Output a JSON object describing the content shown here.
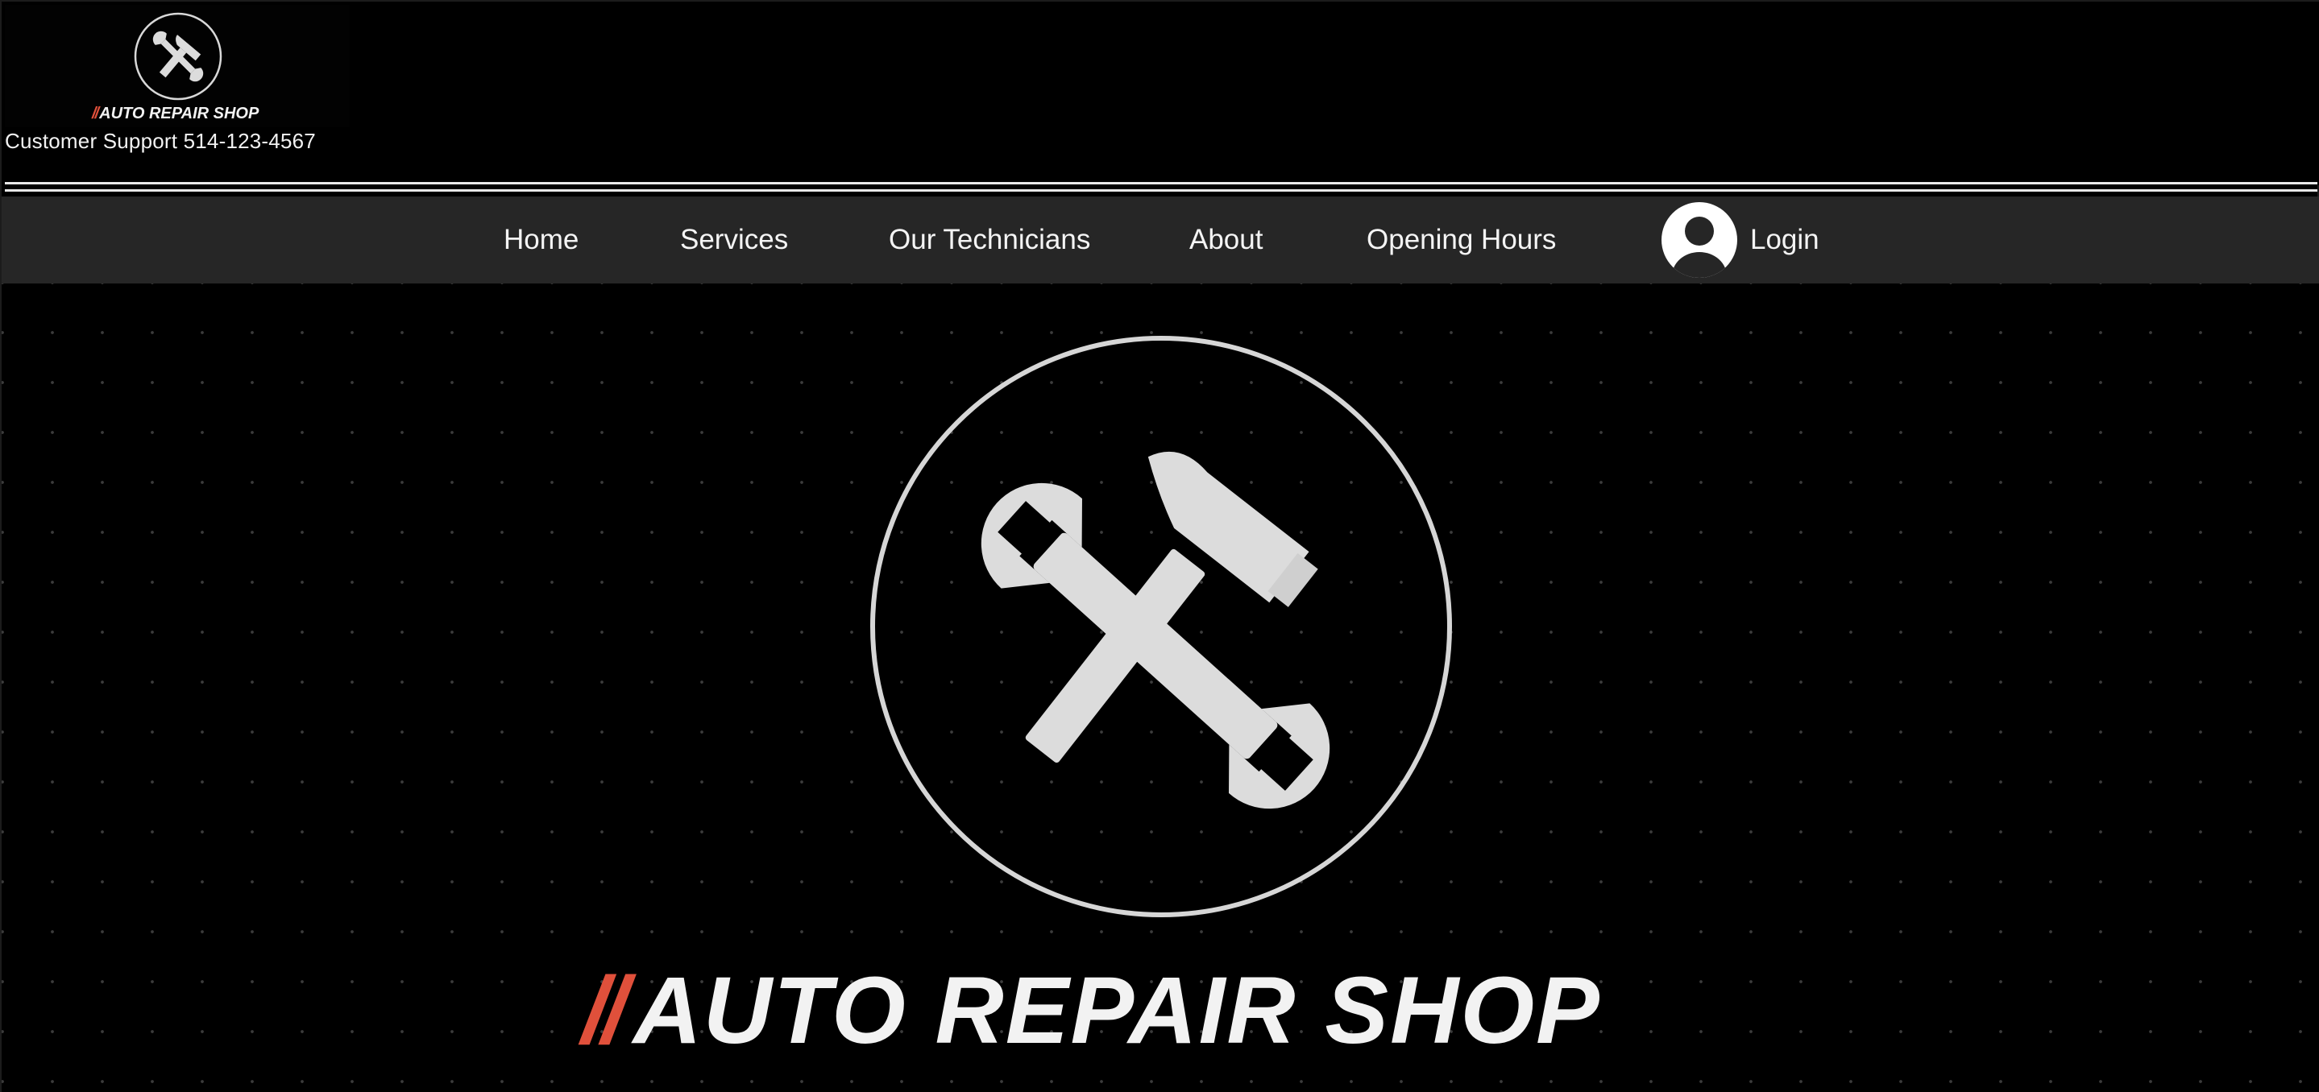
{
  "header": {
    "brand_slashes": "//",
    "brand_name": "AUTO REPAIR SHOP",
    "support_text": "Customer Support 514-123-4567",
    "logo_icon": "hammer-wrench-icon"
  },
  "nav": {
    "items": [
      {
        "label": "Home"
      },
      {
        "label": "Services"
      },
      {
        "label": "Our Technicians"
      },
      {
        "label": "About"
      },
      {
        "label": "Opening Hours"
      }
    ],
    "login_label": "Login",
    "login_icon": "user-avatar-icon"
  },
  "hero": {
    "brand_slashes": "//",
    "brand_name": "AUTO REPAIR SHOP",
    "logo_icon": "hammer-wrench-icon"
  },
  "colors": {
    "background": "#000000",
    "nav_background": "#262626",
    "accent": "#e0503b",
    "foreground": "#f2f2f2"
  }
}
